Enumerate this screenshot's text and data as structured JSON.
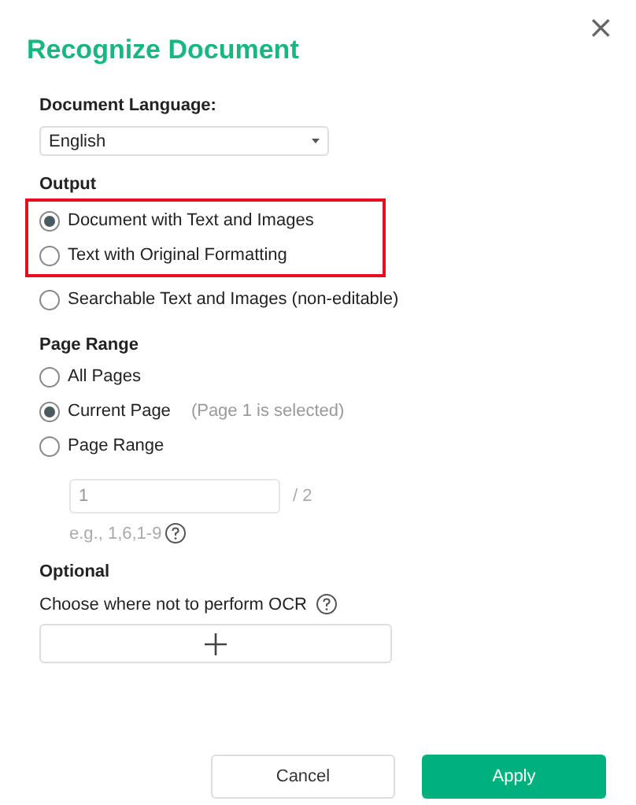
{
  "dialog": {
    "title": "Recognize Document",
    "close": "×"
  },
  "language": {
    "label": "Document Language:",
    "value": "English"
  },
  "output": {
    "label": "Output",
    "options": [
      {
        "label": "Document with Text and Images",
        "selected": true,
        "highlighted": true
      },
      {
        "label": "Text with Original Formatting",
        "selected": false,
        "highlighted": true
      },
      {
        "label": "Searchable Text and Images (non-editable)",
        "selected": false,
        "highlighted": false
      }
    ]
  },
  "page_range": {
    "label": "Page Range",
    "options": [
      {
        "label": "All Pages",
        "selected": false
      },
      {
        "label": "Current Page",
        "note": "(Page 1 is selected)",
        "selected": true
      },
      {
        "label": "Page Range",
        "selected": false
      }
    ],
    "field": {
      "placeholder": "1",
      "total": "/ 2",
      "hint": "e.g., 1,6,1-9"
    }
  },
  "optional": {
    "label": "Optional",
    "text": "Choose where not to perform OCR"
  },
  "buttons": [
    {
      "label": "Cancel",
      "kind": "secondary"
    },
    {
      "label": "Apply",
      "kind": "primary"
    }
  ]
}
